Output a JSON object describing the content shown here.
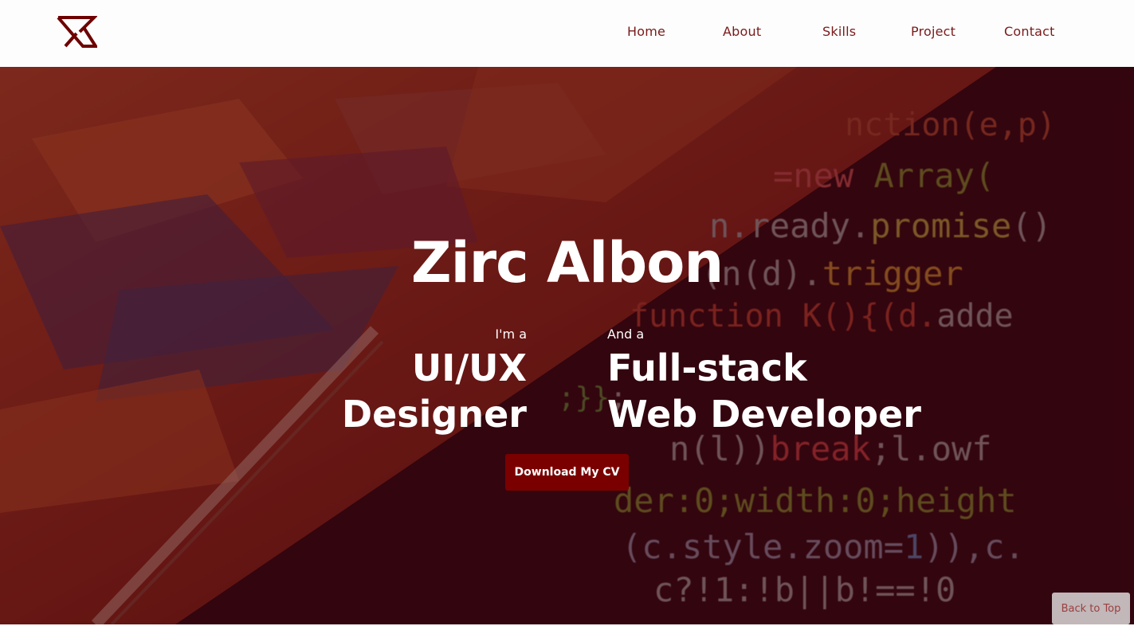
{
  "nav": {
    "logo": "logo-icon",
    "items": [
      "Home",
      "About",
      "Skills",
      "Project",
      "Contact"
    ]
  },
  "hero": {
    "name": "Zirc Albon",
    "left": {
      "intro": "I'm a",
      "line1": "UI/UX",
      "line2": "Designer"
    },
    "right": {
      "intro": "And a",
      "line1": "Full-stack",
      "line2": "Web Developer"
    },
    "cta": "Download My CV"
  },
  "back_to_top": "Back to Top",
  "colors": {
    "accent": "#7a0000",
    "nav_text": "#7a1a1a",
    "hero_overlay": "#3c000c"
  }
}
